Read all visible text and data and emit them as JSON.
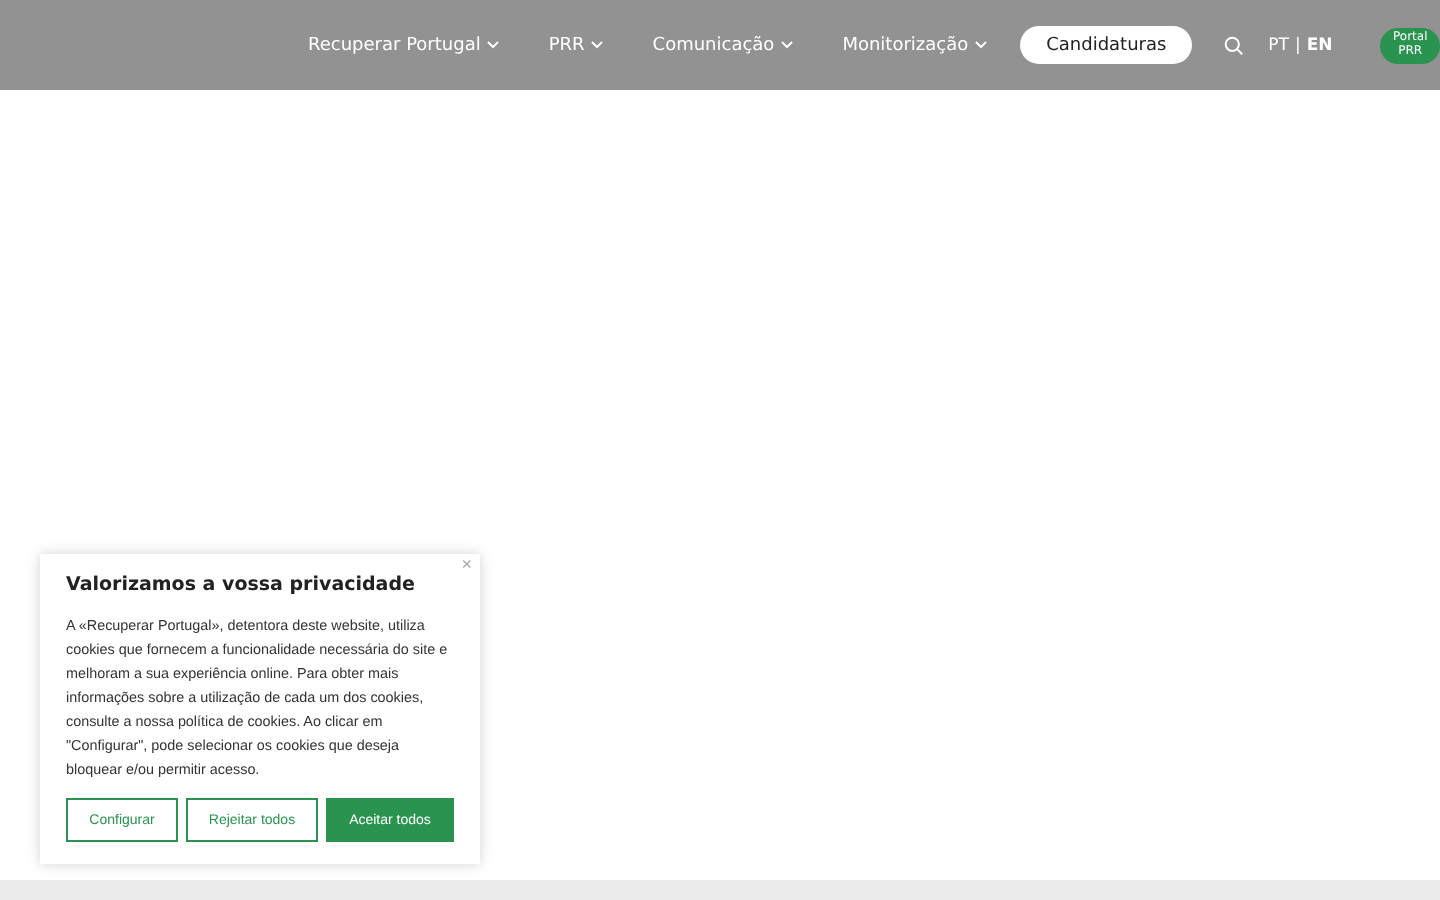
{
  "nav": {
    "items": [
      {
        "label": "Recuperar Portugal"
      },
      {
        "label": "PRR"
      },
      {
        "label": "Comunicação"
      },
      {
        "label": "Monitorização"
      }
    ],
    "cta": "Candidaturas",
    "languages": [
      {
        "label": "PT",
        "selected": false
      },
      {
        "label": "EN",
        "selected": true
      }
    ],
    "separator": "|",
    "portal": [
      "Portal",
      "PRR"
    ]
  },
  "cookie_banner": {
    "close": "×",
    "title": "Valorizamos a vossa privacidade",
    "text": "A «Recuperar Portugal», detentora deste website, utiliza cookies que fornecem a funcionalidade necessária do site e melhoram a sua experiência online. Para obter mais informações sobre a utilização de cada um dos cookies, consulte a nossa política de cookies. Ao clicar em \"Configurar\", pode selecionar os cookies que deseja bloquear e/ou permitir acesso.",
    "buttons": [
      {
        "label": "Configurar",
        "kind": "outline"
      },
      {
        "label": "Rejeitar todos",
        "kind": "outline"
      },
      {
        "label": "Aceitar todos",
        "kind": "primary"
      }
    ]
  }
}
